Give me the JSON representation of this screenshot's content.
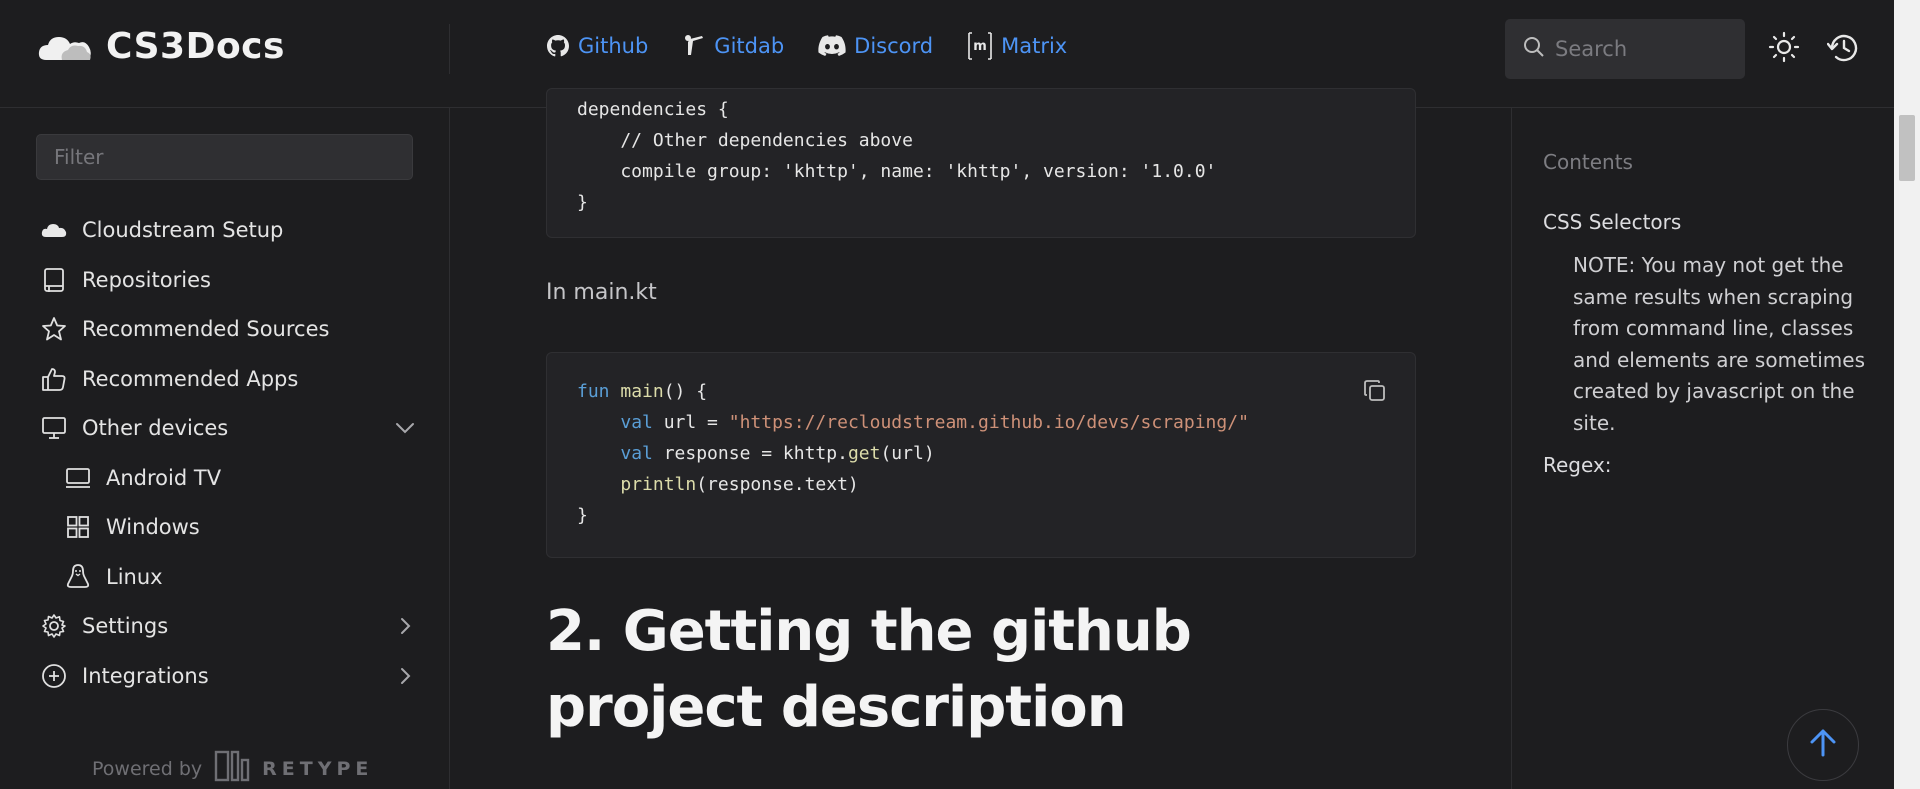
{
  "header": {
    "brand": "CS3Docs",
    "links": [
      {
        "label": "Github",
        "icon": "github-icon"
      },
      {
        "label": "Gitdab",
        "icon": "gitdab-icon"
      },
      {
        "label": "Discord",
        "icon": "discord-icon"
      },
      {
        "label": "Matrix",
        "icon": "matrix-icon"
      }
    ],
    "search_placeholder": "Search"
  },
  "sidebar": {
    "filter_placeholder": "Filter",
    "items": [
      {
        "label": "Cloudstream Setup",
        "icon": "cloud-icon"
      },
      {
        "label": "Repositories",
        "icon": "book-icon"
      },
      {
        "label": "Recommended Sources",
        "icon": "star-icon"
      },
      {
        "label": "Recommended Apps",
        "icon": "thumbs-up-icon"
      },
      {
        "label": "Other devices",
        "icon": "monitor-icon",
        "expanded": true
      },
      {
        "label": "Android TV",
        "icon": "tv-icon"
      },
      {
        "label": "Windows",
        "icon": "windows-icon"
      },
      {
        "label": "Linux",
        "icon": "linux-icon"
      },
      {
        "label": "Settings",
        "icon": "gear-icon"
      },
      {
        "label": "Integrations",
        "icon": "plus-circle-icon"
      }
    ],
    "powered_by": "Powered by",
    "powered_brand": "RETYPE"
  },
  "main": {
    "code1": {
      "lines": [
        "dependencies {",
        "    // Other dependencies above",
        "    compile group: 'khttp', name: 'khttp', version: '1.0.0'",
        "}"
      ]
    },
    "paragraph": "In main.kt",
    "code2": {
      "kw_fun": "fun",
      "fn_main": "main",
      "main_rest": "() {",
      "kw_val": "val",
      "url_mid": " url = ",
      "url_str": "\"https://recloudstream.github.io/devs/scraping/\"",
      "resp_mid": " response = khttp.",
      "fn_get": "get",
      "resp_rest": "(url)",
      "fn_println": "println",
      "println_rest": "(response.text)",
      "close": "}"
    },
    "heading": "2. Getting the github project description"
  },
  "toc": {
    "title": "Contents",
    "items": [
      "CSS Selectors",
      "Regex:"
    ],
    "sub_item": "NOTE: You may not get the same results when scraping from command line, classes and elements are sometimes created by javascript on the site."
  },
  "colors": {
    "background": "#1d1d1f",
    "link": "#4d94f5",
    "keyword": "#5a9ed6",
    "function": "#dcdcaa",
    "string": "#ce9178"
  }
}
